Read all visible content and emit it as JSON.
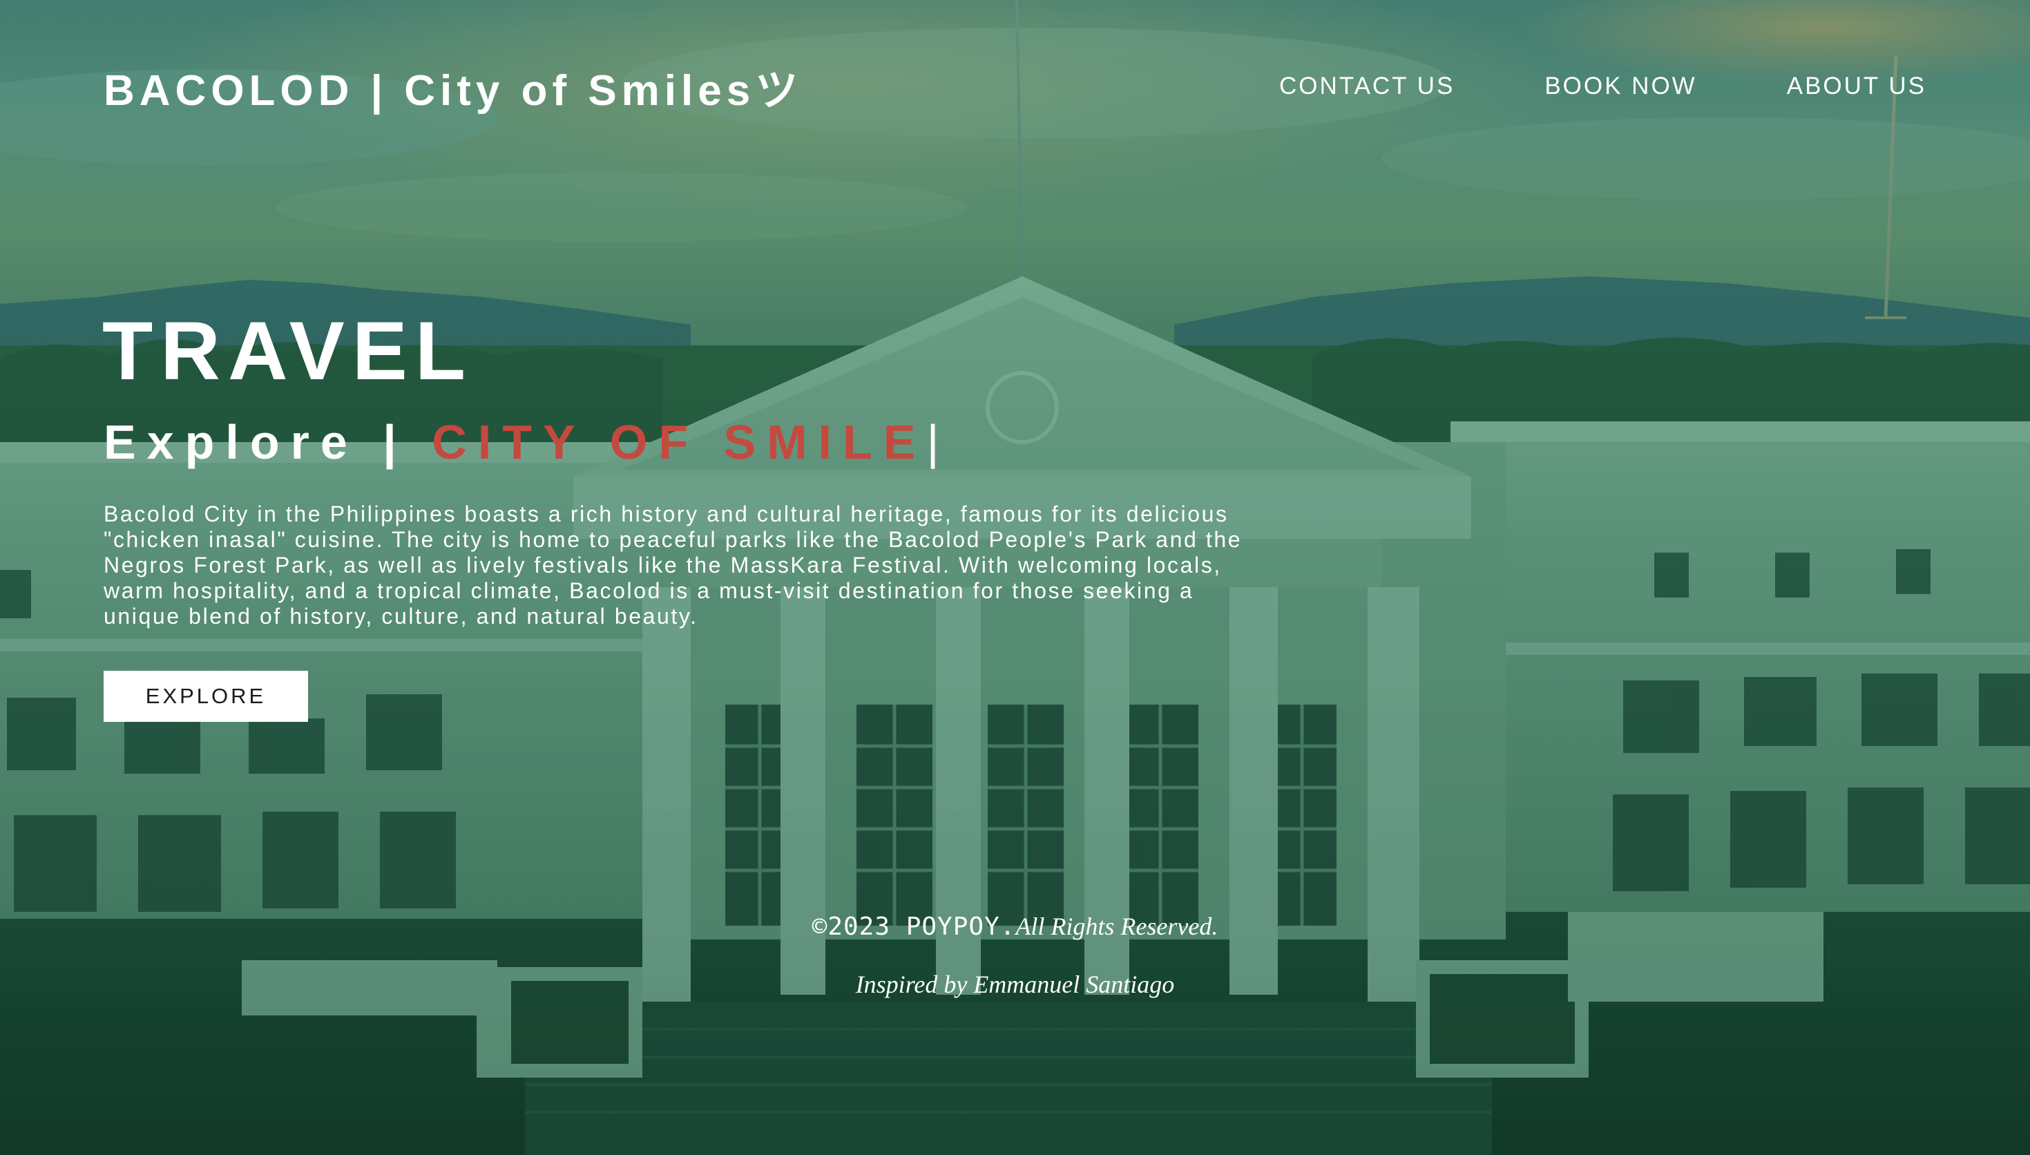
{
  "header": {
    "brand": "BACOLOD | City of Smilesツ",
    "nav": [
      {
        "label": "CONTACT US"
      },
      {
        "label": "BOOK NOW"
      },
      {
        "label": "ABOUT US"
      }
    ]
  },
  "hero": {
    "title": "TRAVEL",
    "subtitle_prefix": "Explore | ",
    "subtitle_accent": "CITY OF SMILE",
    "subtitle_cursor": "|",
    "description": "Bacolod City in the Philippines boasts a rich history and cultural heritage, famous for its delicious \"chicken inasal\" cuisine. The city is home to peaceful parks like the Bacolod People's Park and the Negros Forest Park, as well as lively festivals like the MassKara Festival. With welcoming locals, warm hospitality, and a tropical climate, Bacolod is a must-visit destination for those seeking a unique blend of history, culture, and natural beauty.",
    "button_label": "EXPLORE"
  },
  "footer": {
    "copyright_mark": "©2023 POYPOY.",
    "copyright_text": "All Rights Reserved.",
    "credit": "Inspired by Emmanuel Santiago"
  },
  "colors": {
    "accent": "#c4493f",
    "overlay": "#1f6b4e",
    "text": "#ffffff",
    "button_bg": "#ffffff"
  }
}
